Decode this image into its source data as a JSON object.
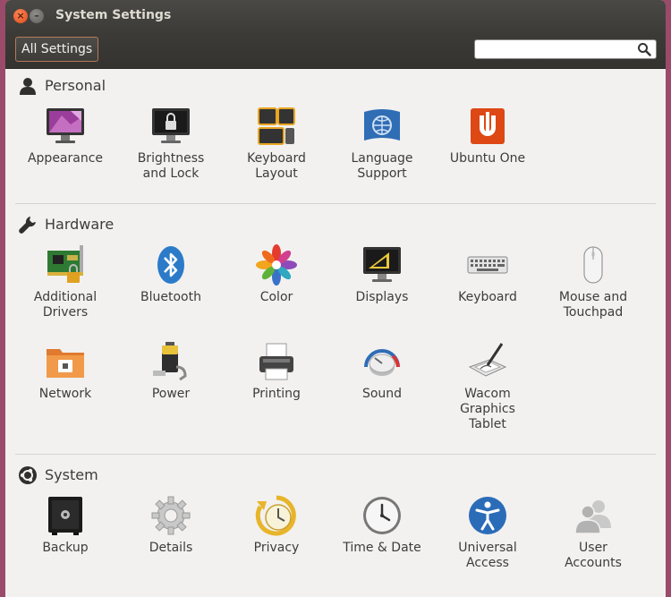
{
  "window": {
    "title": "System Settings"
  },
  "toolbar": {
    "all_settings_label": "All Settings",
    "search_placeholder": ""
  },
  "sections": {
    "personal": {
      "title": "Personal",
      "items": [
        "Appearance",
        "Brightness\nand Lock",
        "Keyboard\nLayout",
        "Language\nSupport",
        "Ubuntu One"
      ]
    },
    "hardware": {
      "title": "Hardware",
      "items": [
        "Additional\nDrivers",
        "Bluetooth",
        "Color",
        "Displays",
        "Keyboard",
        "Mouse and\nTouchpad",
        "Network",
        "Power",
        "Printing",
        "Sound",
        "Wacom\nGraphics\nTablet"
      ]
    },
    "system": {
      "title": "System",
      "items": [
        "Backup",
        "Details",
        "Privacy",
        "Time & Date",
        "Universal\nAccess",
        "User\nAccounts"
      ]
    }
  },
  "colors": {
    "accent": "#dd4814",
    "titlebar": "#3c3b37",
    "background": "#f2f1f0"
  }
}
